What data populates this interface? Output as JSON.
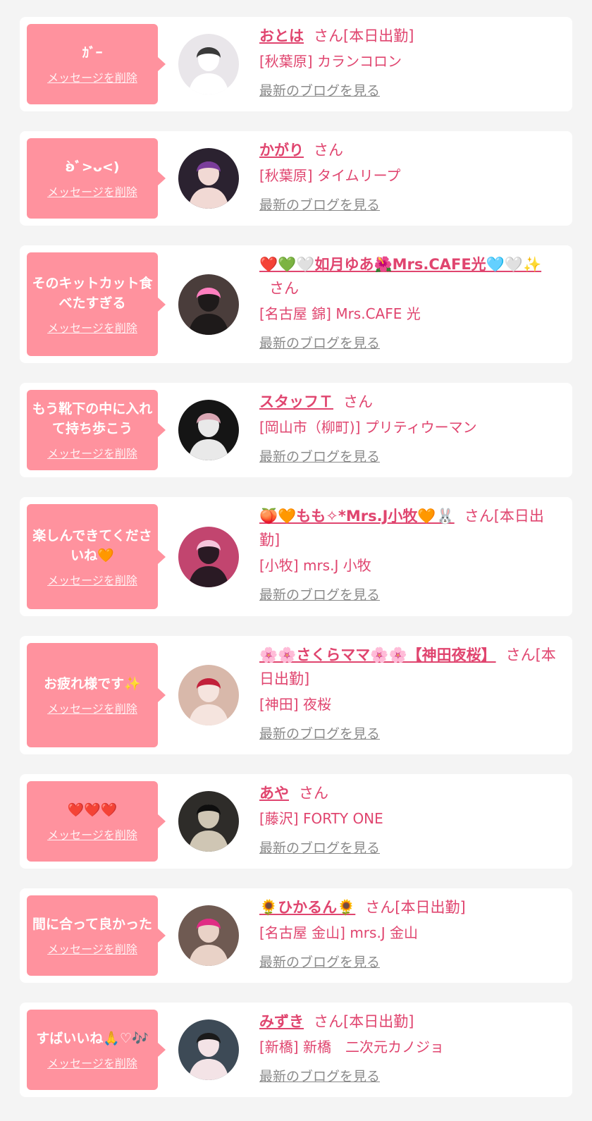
{
  "items": [
    {
      "message": "ｶﾞｰ",
      "delete_label": "メッセージを削除",
      "name": "おとは",
      "suffix": "さん[本日出勤]",
      "shop": "[秋葉原] カランコロン",
      "blog_link": "最新のブログを見る",
      "avatar": {
        "bg": "#e9e6ea",
        "fg": "#ffffff",
        "accent": "#3a3a3a"
      }
    },
    {
      "message": "ʚ̀ﾞ>ᴗ<)",
      "delete_label": "メッセージを削除",
      "name": "かがり",
      "suffix": "さん",
      "shop": "[秋葉原] タイムリープ",
      "blog_link": "最新のブログを見る",
      "avatar": {
        "bg": "#2b2230",
        "fg": "#f1d9d4",
        "accent": "#7a3d9a"
      }
    },
    {
      "message": "そのキットカット食べたすぎる",
      "delete_label": "メッセージを削除",
      "name": "❤️💚🤍如月ゆあ🌺Mrs.CAFE光🩵🤍✨",
      "suffix": "さん",
      "shop": "[名古屋 錦] Mrs.CAFE 光",
      "blog_link": "最新のブログを見る",
      "avatar": {
        "bg": "#4a3d3b",
        "fg": "#1e1a1a",
        "accent": "#ff7fbf"
      }
    },
    {
      "message": "もう靴下の中に入れて持ち歩こう",
      "delete_label": "メッセージを削除",
      "name": "スタッフＴ",
      "suffix": "さん",
      "shop": "[岡山市（柳町)] プリティウーマン",
      "blog_link": "最新のブログを見る",
      "avatar": {
        "bg": "#151515",
        "fg": "#e9e9e9",
        "accent": "#d9a6b3"
      }
    },
    {
      "message": "楽しんできてくださいね🧡",
      "delete_label": "メッセージを削除",
      "name": "🍑🧡もも✧*Mrs.J小牧🧡🐰",
      "suffix": "さん[本日出勤]",
      "shop": "[小牧] mrs.J 小牧",
      "blog_link": "最新のブログを見る",
      "avatar": {
        "bg": "#c2456f",
        "fg": "#2a1a24",
        "accent": "#f6c6dc"
      }
    },
    {
      "message": "お疲れ様です✨",
      "delete_label": "メッセージを削除",
      "name": "🌸🌸さくらママ🌸🌸【神田夜桜】",
      "suffix": "さん[本日出勤]",
      "shop": "[神田] 夜桜",
      "blog_link": "最新のブログを見る",
      "avatar": {
        "bg": "#d8b8aa",
        "fg": "#f5e4de",
        "accent": "#c2203a"
      }
    },
    {
      "message": "❤️❤️❤️",
      "delete_label": "メッセージを削除",
      "name": "あや",
      "suffix": "さん",
      "shop": "[藤沢] FORTY ONE",
      "blog_link": "最新のブログを見る",
      "avatar": {
        "bg": "#2e2c29",
        "fg": "#cfc6b4",
        "accent": "#0e0e0e"
      }
    },
    {
      "message": "間に合って良かった",
      "delete_label": "メッセージを削除",
      "name": "🌻ひかるん🌻",
      "suffix": "さん[本日出勤]",
      "shop": "[名古屋 金山] mrs.J 金山",
      "blog_link": "最新のブログを見る",
      "avatar": {
        "bg": "#6f5a52",
        "fg": "#e9d2c7",
        "accent": "#e02c84"
      }
    },
    {
      "message": "すばいいね🙏♡🎶",
      "delete_label": "メッセージを削除",
      "name": "みずき",
      "suffix": "さん[本日出勤]",
      "shop": "[新橋] 新橋　二次元カノジョ",
      "blog_link": "最新のブログを見る",
      "avatar": {
        "bg": "#3d4a56",
        "fg": "#f3e3e6",
        "accent": "#1a1a1a"
      }
    }
  ]
}
